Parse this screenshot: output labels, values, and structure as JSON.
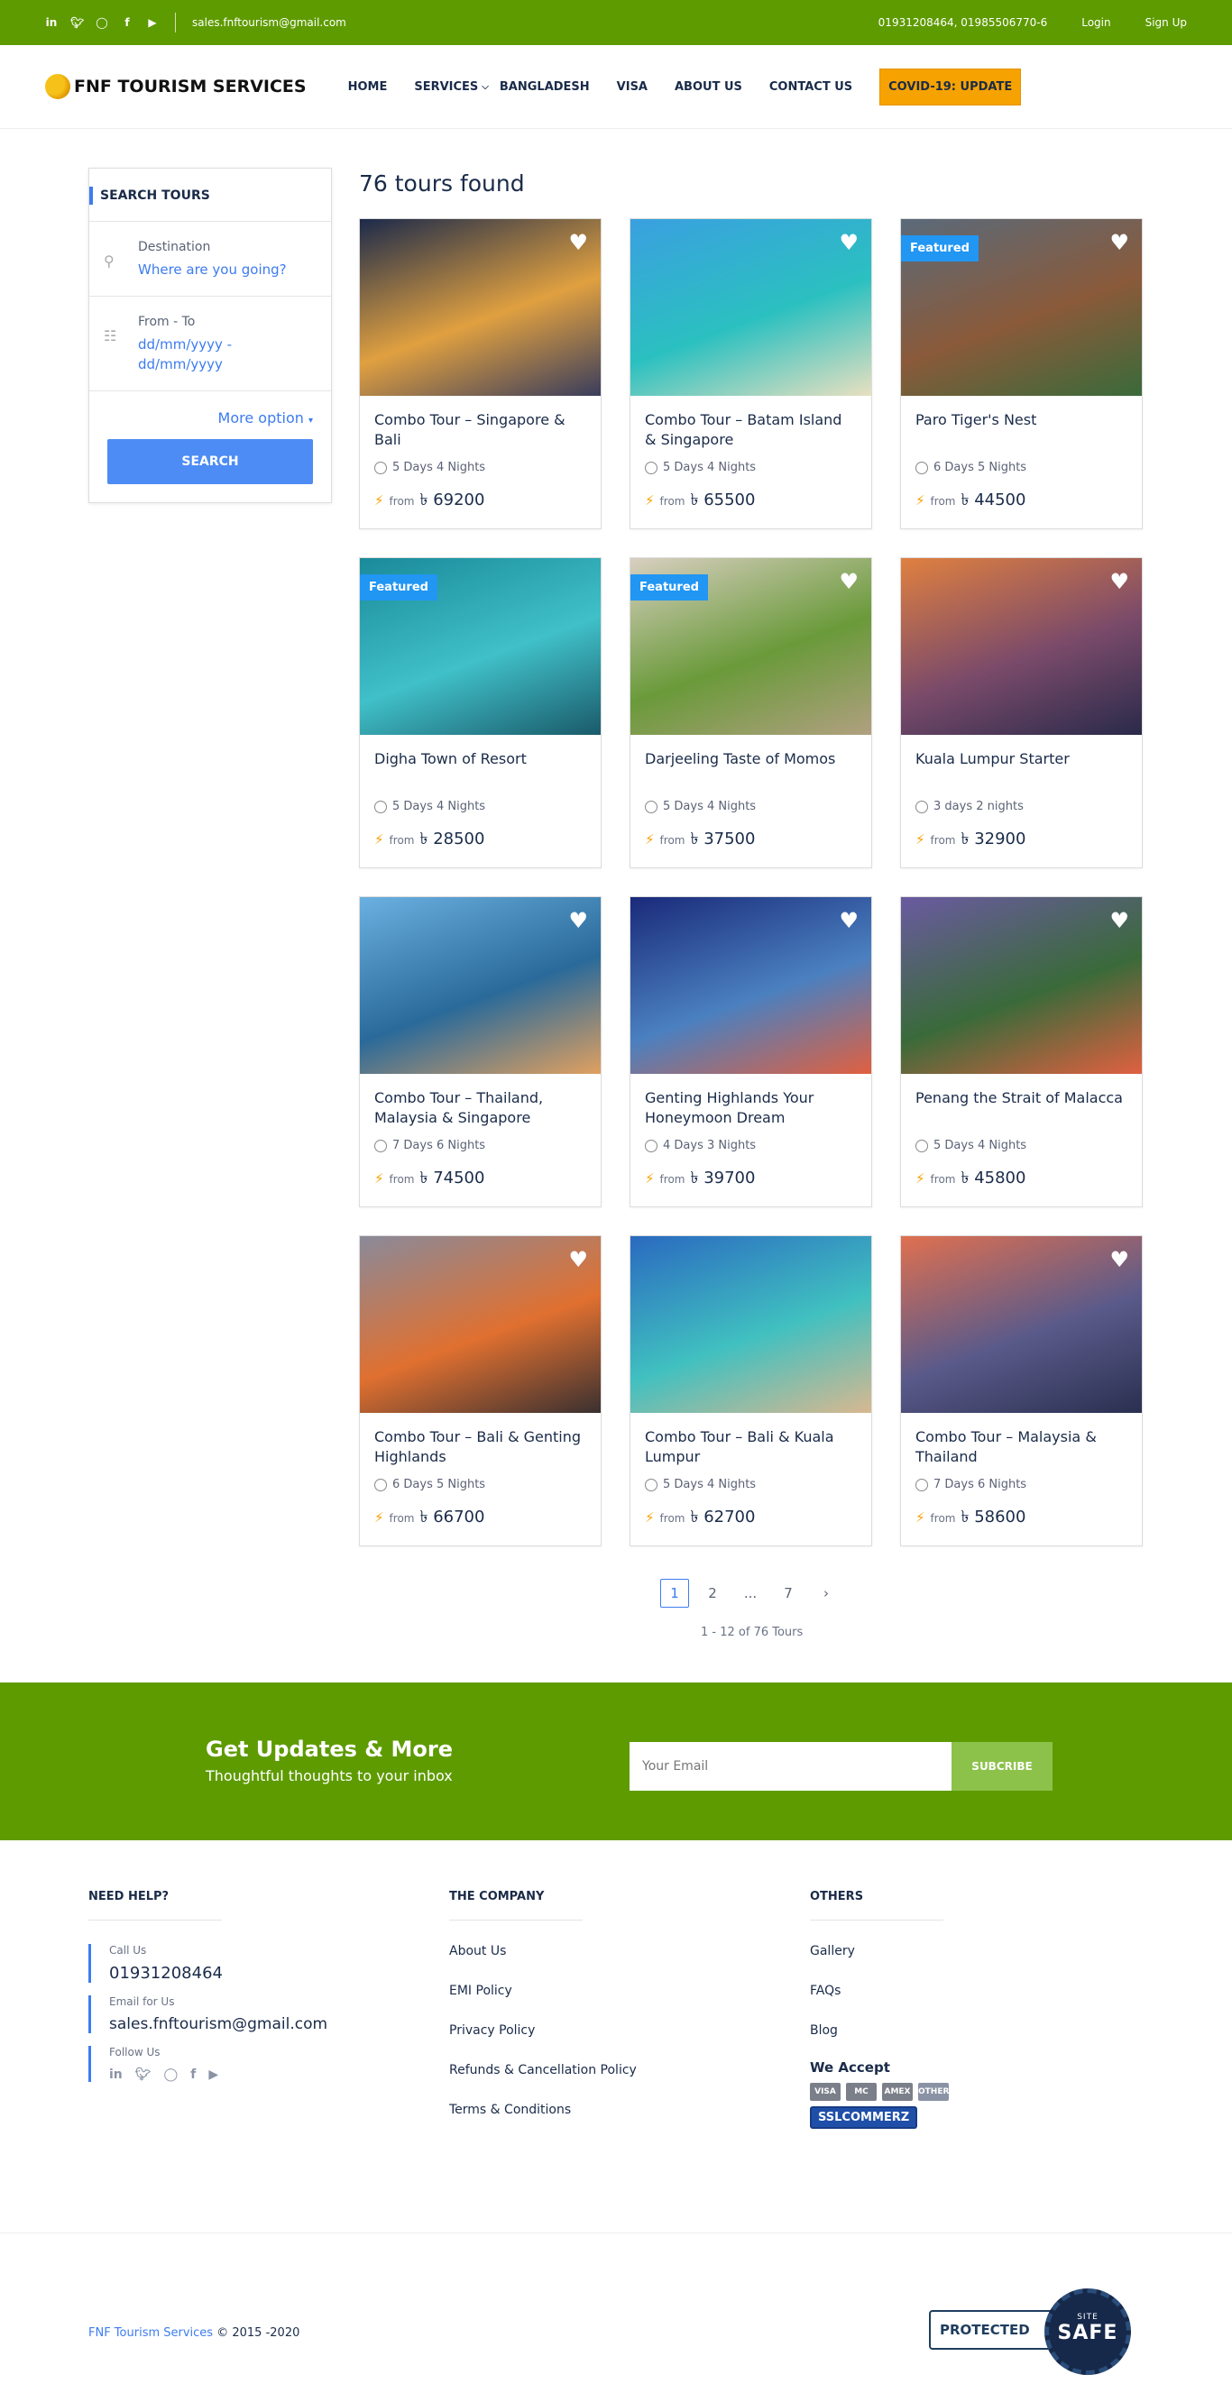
{
  "topbar": {
    "social_icons": [
      "linkedin-icon",
      "twitter-icon",
      "instagram-icon",
      "facebook-icon",
      "youtube-icon"
    ],
    "email": "sales.fnftourism@gmail.com",
    "phones": "01931208464, 01985506770-6",
    "login": "Login",
    "signup": "Sign Up"
  },
  "header": {
    "logo_text": "FNF TOURISM SERVICES",
    "nav": {
      "home": "HOME",
      "services": "SERVICES",
      "bangladesh": "BANGLADESH",
      "visa": "VISA",
      "about": "ABOUT US",
      "contact": "CONTACT US",
      "covid": "COVID-19: UPDATE"
    }
  },
  "search": {
    "title": "SEARCH TOURS",
    "destination_label": "Destination",
    "destination_placeholder": "Where are you going?",
    "date_label": "From - To",
    "date_placeholder": "dd/mm/yyyy - dd/mm/yyyy",
    "more_option": "More option",
    "button": "SEARCH"
  },
  "results": {
    "count_text": "76 tours found",
    "from_label": "from",
    "currency": "৳",
    "featured_label": "Featured",
    "tours": [
      {
        "title": "Combo Tour – Singapore & Bali",
        "duration": "5 Days 4 Nights",
        "price": "69200",
        "featured": false,
        "heart": true,
        "img": [
          "#1c2a4a",
          "#e0a040",
          "#3a3d5c"
        ]
      },
      {
        "title": "Combo Tour – Batam Island & Singapore",
        "duration": "5 Days 4 Nights",
        "price": "65500",
        "featured": false,
        "heart": true,
        "img": [
          "#3aa0e0",
          "#2bc0c0",
          "#e8e0c0"
        ]
      },
      {
        "title": "Paro Tiger's Nest",
        "duration": "6 Days 5 Nights",
        "price": "44500",
        "featured": true,
        "heart": true,
        "img": [
          "#5a6a7a",
          "#8a5a3a",
          "#3a6a3a"
        ]
      },
      {
        "title": "Digha Town of Resort",
        "duration": "5 Days 4 Nights",
        "price": "28500",
        "featured": true,
        "heart": false,
        "img": [
          "#1a8a9a",
          "#40c0c8",
          "#1a5a6a"
        ]
      },
      {
        "title": "Darjeeling Taste of Momos",
        "duration": "5 Days 4 Nights",
        "price": "37500",
        "featured": true,
        "heart": true,
        "img": [
          "#d8cfc0",
          "#6a9a3a",
          "#b0a080"
        ]
      },
      {
        "title": "Kuala Lumpur Starter",
        "duration": "3 days 2 nights",
        "price": "32900",
        "featured": false,
        "heart": true,
        "img": [
          "#e08040",
          "#7a4a6a",
          "#2a2a4a"
        ]
      },
      {
        "title": "Combo Tour – Thailand, Malaysia & Singapore",
        "duration": "7 Days 6 Nights",
        "price": "74500",
        "featured": false,
        "heart": true,
        "img": [
          "#6ab0e0",
          "#2a6a9a",
          "#e0a060"
        ]
      },
      {
        "title": "Genting Highlands Your Honeymoon Dream",
        "duration": "4 Days 3 Nights",
        "price": "39700",
        "featured": false,
        "heart": true,
        "img": [
          "#1a2a7a",
          "#4a80c0",
          "#e06040"
        ]
      },
      {
        "title": "Penang the Strait of Malacca",
        "duration": "5 Days 4 Nights",
        "price": "45800",
        "featured": false,
        "heart": true,
        "img": [
          "#6a5aa0",
          "#3a6a3a",
          "#e06040"
        ]
      },
      {
        "title": "Combo Tour – Bali & Genting Highlands",
        "duration": "6 Days 5 Nights",
        "price": "66700",
        "featured": false,
        "heart": true,
        "img": [
          "#8a8a9a",
          "#e07030",
          "#3a3030"
        ]
      },
      {
        "title": "Combo Tour – Bali & Kuala Lumpur",
        "duration": "5 Days 4 Nights",
        "price": "62700",
        "featured": false,
        "heart": false,
        "img": [
          "#2a6ac0",
          "#40c0c0",
          "#d8b890"
        ]
      },
      {
        "title": "Combo Tour – Malaysia & Thailand",
        "duration": "7 Days 6 Nights",
        "price": "58600",
        "featured": false,
        "heart": true,
        "img": [
          "#e07050",
          "#5a5a8a",
          "#2a3050"
        ]
      }
    ]
  },
  "pagination": {
    "pages": [
      "1",
      "2",
      "...",
      "7"
    ],
    "next": "›",
    "info": "1 - 12 of 76 Tours"
  },
  "newsletter": {
    "heading": "Get Updates & More",
    "subheading": "Thoughtful thoughts to your inbox",
    "placeholder": "Your Email",
    "button": "SUBCRIBE"
  },
  "footer": {
    "help_heading": "NEED HELP?",
    "call_label": "Call Us",
    "call_value": "01931208464",
    "email_label": "Email for Us",
    "email_value": "sales.fnftourism@gmail.com",
    "follow_label": "Follow Us",
    "company_heading": "THE COMPANY",
    "company_links": [
      "About Us",
      "EMI Policy",
      "Privacy Policy",
      "Refunds & Cancellation Policy",
      "Terms & Conditions"
    ],
    "others_heading": "OTHERS",
    "others_links": [
      "Gallery",
      "FAQs",
      "Blog"
    ],
    "accept_heading": "We Accept",
    "payment_cards": [
      "VISA",
      "MC",
      "AMEX",
      "OTHER"
    ],
    "ssl_logo": "SSLCOMMERZ",
    "copyright_brand": "FNF Tourism Services",
    "copyright_years": "© 2015 -2020",
    "badge_protected": "PROTECTED",
    "badge_site": "SITE",
    "badge_safe": "SAFE"
  }
}
